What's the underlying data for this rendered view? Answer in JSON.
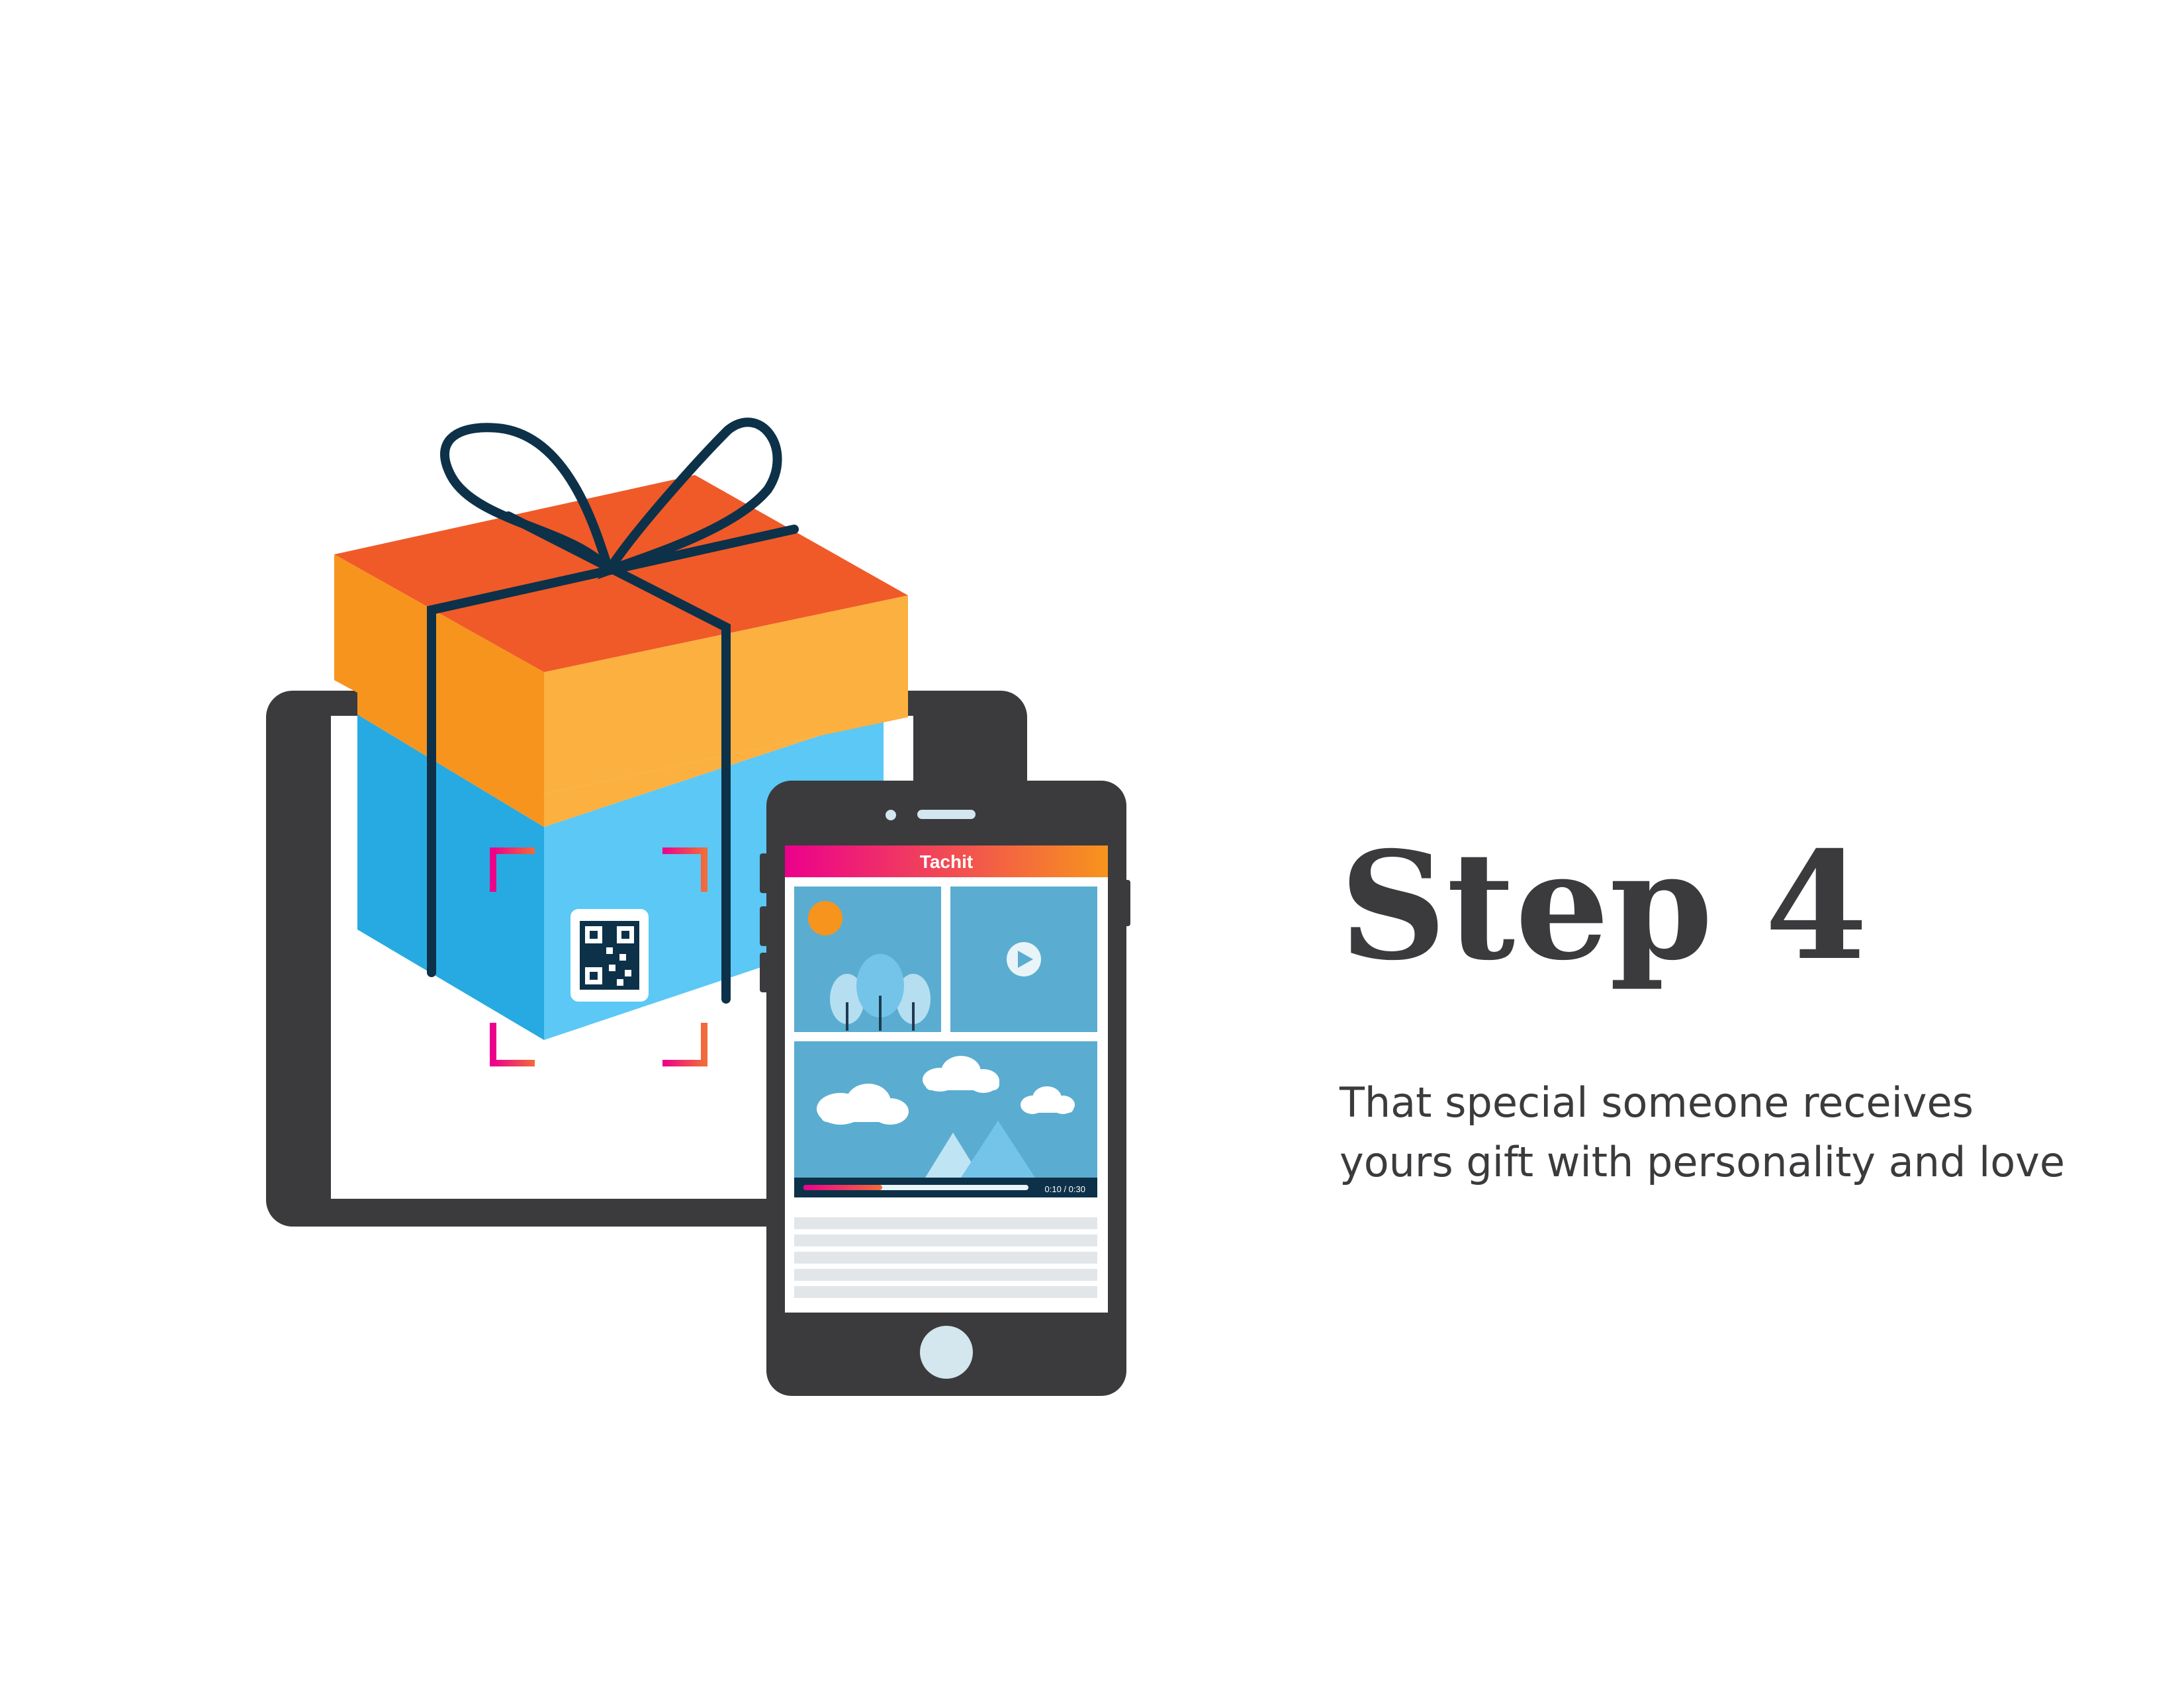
{
  "heading": "Step 4",
  "description": {
    "line1": "That special someone receives",
    "line2": "yours gift with personality and love"
  },
  "app": {
    "brand": "Tachit",
    "video_time": "0:10 / 0:30",
    "video_progress": 0.35
  },
  "icons": [
    "gift-box-icon",
    "ribbon-bow-icon",
    "tablet-icon",
    "smartphone-icon",
    "qr-code-icon",
    "scan-frame-icon",
    "play-icon",
    "cloud-icon",
    "mountain-icon",
    "tree-icon",
    "sun-icon",
    "home-button-icon"
  ],
  "colors": {
    "text": "#3b3b3d",
    "device": "#3b3b3d",
    "box_lid_top": "#f05a28",
    "box_lid_left": "#f7941d",
    "box_lid_right": "#fbb040",
    "box_left": "#27aae1",
    "box_right": "#5bc8f5",
    "ribbon": "#0d3149",
    "scan_start": "#ec008c",
    "scan_end": "#f7941d",
    "screen_tile": "#5aadd0"
  }
}
